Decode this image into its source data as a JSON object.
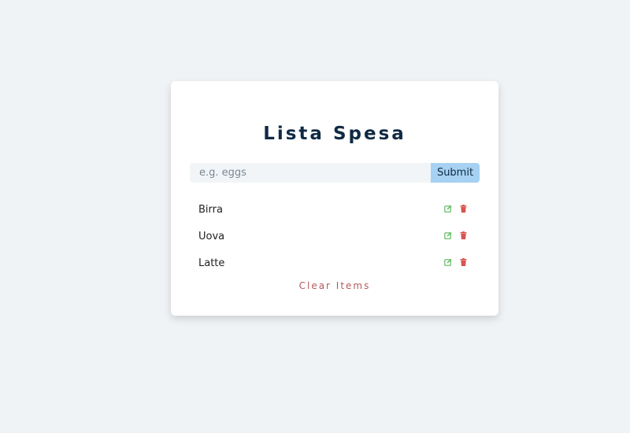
{
  "app": {
    "title": "Lista Spesa"
  },
  "form": {
    "input_placeholder": "e.g. eggs",
    "input_value": "",
    "submit_label": "Submit"
  },
  "items": [
    {
      "title": "Birra",
      "edit_icon": "edit-icon",
      "delete_icon": "trash-icon"
    },
    {
      "title": "Uova",
      "edit_icon": "edit-icon",
      "delete_icon": "trash-icon"
    },
    {
      "title": "Latte",
      "edit_icon": "edit-icon",
      "delete_icon": "trash-icon"
    }
  ],
  "clear_label": "Clear Items",
  "colors": {
    "background": "#f0f3f6",
    "title": "#102a43",
    "submit_button": "#a6d1f2",
    "edit_icon": "#5cb85c",
    "delete_icon": "#d9534f",
    "clear_text": "#b25b5b"
  }
}
